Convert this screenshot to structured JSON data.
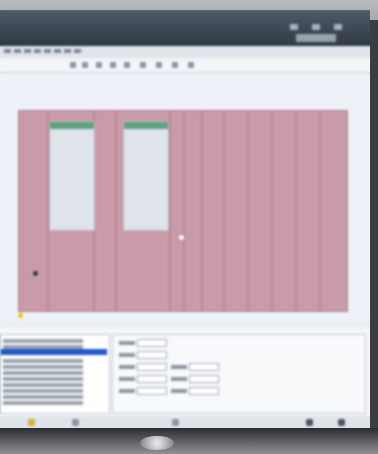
{
  "app": {
    "title": ""
  },
  "colors": {
    "cabinet_fill": "#c99aa8",
    "panel_header": "#5fa27f",
    "selection": "#2457c9",
    "titlebar": "#2f3945"
  },
  "icons": [
    "close-icon",
    "restore-icon",
    "minimize-icon",
    "tool-icon",
    "status-warning-icon",
    "status-info-icon"
  ],
  "panels": {
    "panel_a": {
      "state": "selected-window"
    },
    "panel_b": {
      "state": "selected-window"
    }
  }
}
